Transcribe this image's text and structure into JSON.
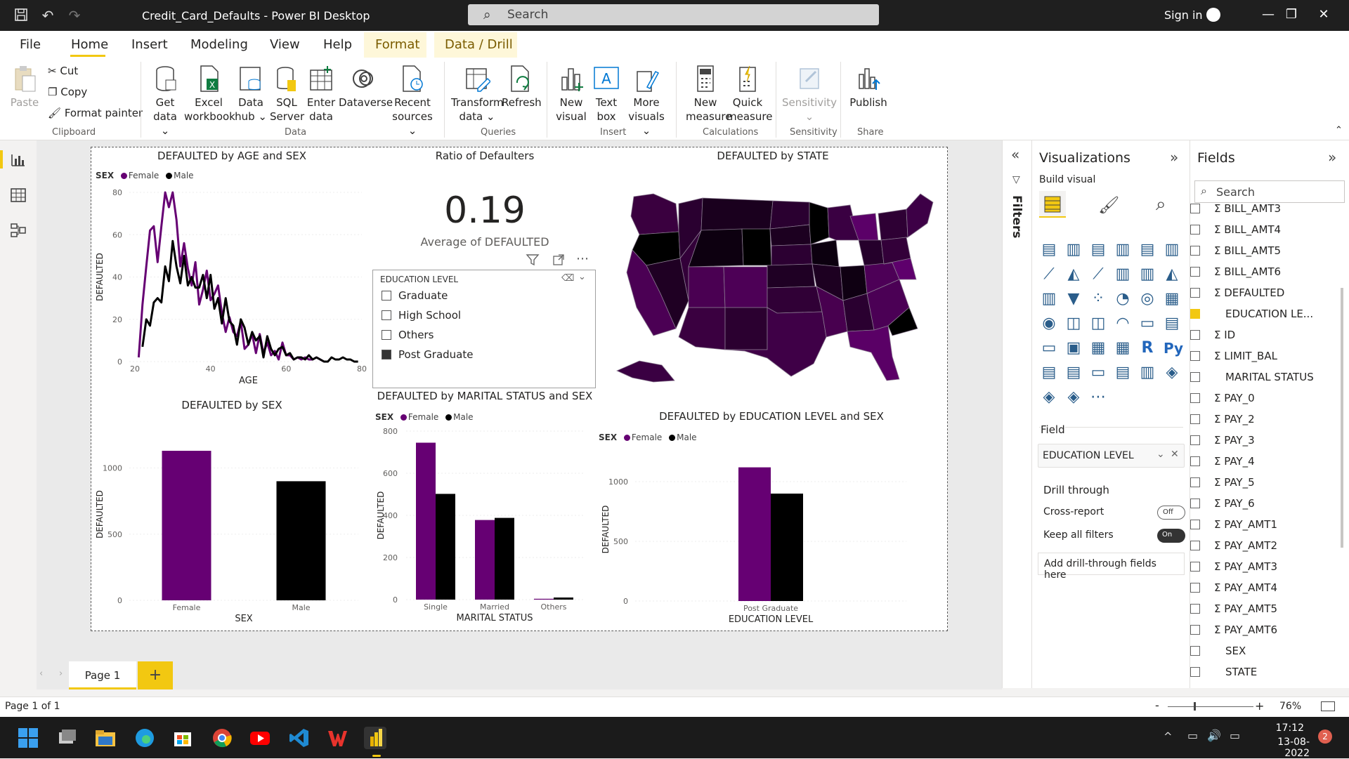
{
  "titlebar": {
    "title": "Credit_Card_Defaults - Power BI Desktop",
    "search_placeholder": "Search",
    "signin": "Sign in"
  },
  "menu": {
    "items": [
      "File",
      "Home",
      "Insert",
      "Modeling",
      "View",
      "Help",
      "Format",
      "Data / Drill"
    ]
  },
  "ribbon": {
    "clipboard": {
      "paste": "Paste",
      "cut": "Cut",
      "copy": "Copy",
      "format_painter": "Format painter",
      "label": "Clipboard"
    },
    "data": {
      "get_data": [
        "Get",
        "data ⌄"
      ],
      "excel": [
        "Excel",
        "workbook"
      ],
      "data_hub": [
        "Data",
        "hub ⌄"
      ],
      "sql": [
        "SQL",
        "Server"
      ],
      "enter": [
        "Enter",
        "data"
      ],
      "dataverse": [
        "Dataverse",
        ""
      ],
      "recent": [
        "Recent",
        "sources ⌄"
      ],
      "label": "Data"
    },
    "queries": {
      "transform": [
        "Transform",
        "data ⌄"
      ],
      "refresh": [
        "Refresh",
        ""
      ],
      "label": "Queries"
    },
    "insert": {
      "new_visual": [
        "New",
        "visual"
      ],
      "text_box": [
        "Text",
        "box"
      ],
      "more": [
        "More",
        "visuals ⌄"
      ],
      "label": "Insert"
    },
    "calculations": {
      "new_measure": [
        "New",
        "measure"
      ],
      "quick_measure": [
        "Quick",
        "measure"
      ],
      "label": "Calculations"
    },
    "sensitivity": {
      "btn": [
        "Sensitivity",
        "⌄"
      ],
      "label": "Sensitivity"
    },
    "share": {
      "publish": [
        "Publish",
        ""
      ],
      "label": "Share"
    }
  },
  "visuals": {
    "age_chart": {
      "title": "DEFAULTED by AGE and SEX",
      "legend_title": "SEX",
      "legend": [
        "Female",
        "Male"
      ],
      "xlabel": "AGE",
      "ylabel": "DEFAULTED"
    },
    "card": {
      "title": "Ratio of Defaulters",
      "value": "0.19",
      "label": "Average of DEFAULTED"
    },
    "slicer": {
      "title": "EDUCATION LEVEL",
      "items": [
        "Graduate",
        "High School",
        "Others",
        "Post Graduate"
      ],
      "selected": "Post Graduate"
    },
    "map": {
      "title": "DEFAULTED by STATE"
    },
    "sex_chart": {
      "title": "DEFAULTED by SEX",
      "xlabel": "SEX",
      "ylabel": "DEFAULTED"
    },
    "marital_chart": {
      "title": "DEFAULTED by MARITAL STATUS and SEX",
      "legend_title": "SEX",
      "legend": [
        "Female",
        "Male"
      ],
      "xlabel": "MARITAL STATUS",
      "ylabel": "DEFAULTED"
    },
    "edu_chart": {
      "title": "DEFAULTED by EDUCATION LEVEL and SEX",
      "legend_title": "SEX",
      "legend": [
        "Female",
        "Male"
      ],
      "xlabel": "EDUCATION LEVEL",
      "ylabel": "DEFAULTED"
    }
  },
  "colors": {
    "female": "#660073",
    "male": "#000000",
    "accent": "#f2c811"
  },
  "chart_data": [
    {
      "type": "line",
      "title": "DEFAULTED by AGE and SEX",
      "xlabel": "AGE",
      "ylabel": "DEFAULTED",
      "xlim": [
        20,
        80
      ],
      "ylim": [
        0,
        80
      ],
      "x_ticks": [
        20,
        40,
        60,
        80
      ],
      "y_ticks": [
        0,
        20,
        40,
        60,
        80
      ],
      "series": [
        {
          "name": "Female",
          "x": [
            21,
            22,
            23,
            24,
            25,
            26,
            27,
            28,
            29,
            30,
            31,
            32,
            33,
            34,
            35,
            36,
            37,
            38,
            39,
            40,
            41,
            42,
            43,
            44,
            45,
            46,
            47,
            48,
            49,
            50,
            51,
            52,
            53,
            54,
            55,
            56,
            57,
            58,
            59,
            60,
            61,
            62,
            63,
            64,
            65,
            66,
            67,
            68,
            69,
            70
          ],
          "y": [
            2,
            27,
            45,
            62,
            64,
            47,
            64,
            80,
            73,
            80,
            67,
            45,
            56,
            44,
            36,
            47,
            27,
            34,
            43,
            29,
            32,
            36,
            23,
            14,
            21,
            14,
            12,
            19,
            6,
            8,
            13,
            4,
            13,
            4,
            9,
            3,
            5,
            1,
            9,
            3,
            3,
            1,
            2,
            1,
            2,
            1,
            1,
            2,
            1,
            0
          ]
        },
        {
          "name": "Male",
          "x": [
            22,
            23,
            24,
            25,
            26,
            27,
            28,
            29,
            30,
            31,
            32,
            33,
            34,
            35,
            36,
            37,
            38,
            39,
            40,
            41,
            42,
            43,
            44,
            45,
            46,
            47,
            48,
            49,
            50,
            51,
            52,
            53,
            54,
            55,
            56,
            57,
            58,
            59,
            60,
            61,
            62,
            63,
            64,
            65,
            66,
            67,
            68,
            69,
            70,
            71,
            72,
            73,
            74,
            75,
            76,
            77,
            78,
            79
          ],
          "y": [
            7,
            20,
            17,
            28,
            30,
            28,
            45,
            38,
            57,
            45,
            37,
            50,
            36,
            40,
            35,
            35,
            41,
            30,
            41,
            25,
            30,
            18,
            30,
            19,
            17,
            8,
            20,
            16,
            8,
            14,
            10,
            12,
            2,
            12,
            6,
            3,
            6,
            7,
            3,
            4,
            1,
            2,
            2,
            1,
            3,
            1,
            2,
            1,
            0,
            0,
            2,
            1,
            1,
            2,
            1,
            1,
            0,
            0
          ]
        }
      ]
    },
    {
      "type": "bar",
      "title": "DEFAULTED by SEX",
      "xlabel": "SEX",
      "ylabel": "DEFAULTED",
      "categories": [
        "Female",
        "Male"
      ],
      "values": [
        1130,
        900
      ],
      "ylim": [
        0,
        1300
      ],
      "y_ticks": [
        0,
        500,
        1000
      ]
    },
    {
      "type": "bar",
      "title": "DEFAULTED by MARITAL STATUS and SEX",
      "xlabel": "MARITAL STATUS",
      "ylabel": "DEFAULTED",
      "categories": [
        "Single",
        "Married",
        "Others"
      ],
      "ylim": [
        0,
        800
      ],
      "y_ticks": [
        0,
        200,
        400,
        600,
        800
      ],
      "series": [
        {
          "name": "Female",
          "values": [
            745,
            378,
            4
          ]
        },
        {
          "name": "Male",
          "values": [
            502,
            388,
            10
          ]
        }
      ]
    },
    {
      "type": "bar",
      "title": "DEFAULTED by EDUCATION LEVEL and SEX",
      "xlabel": "EDUCATION LEVEL",
      "ylabel": "DEFAULTED",
      "categories": [
        "Post Graduate"
      ],
      "ylim": [
        0,
        1200
      ],
      "y_ticks": [
        0,
        500,
        1000
      ],
      "series": [
        {
          "name": "Female",
          "values": [
            1120
          ]
        },
        {
          "name": "Male",
          "values": [
            900
          ]
        }
      ]
    }
  ],
  "filters_label": "Filters",
  "viz_pane": {
    "title": "Visualizations",
    "build": "Build visual",
    "field_label": "Field",
    "field_value": "EDUCATION LEVEL",
    "drill_through": "Drill through",
    "cross_report": "Cross-report",
    "cross_report_state": "Off",
    "keep_filters": "Keep all filters",
    "keep_filters_state": "On",
    "add_drill": "Add drill-through fields here"
  },
  "fields_pane": {
    "title": "Fields",
    "search_placeholder": "Search",
    "fields": [
      {
        "name": "BILL_AMT3",
        "sigma": true,
        "checked": false
      },
      {
        "name": "BILL_AMT4",
        "sigma": true,
        "checked": false
      },
      {
        "name": "BILL_AMT5",
        "sigma": true,
        "checked": false
      },
      {
        "name": "BILL_AMT6",
        "sigma": true,
        "checked": false
      },
      {
        "name": "DEFAULTED",
        "sigma": true,
        "checked": false
      },
      {
        "name": "EDUCATION LE...",
        "sigma": false,
        "checked": true
      },
      {
        "name": "ID",
        "sigma": true,
        "checked": false
      },
      {
        "name": "LIMIT_BAL",
        "sigma": true,
        "checked": false
      },
      {
        "name": "MARITAL STATUS",
        "sigma": false,
        "checked": false
      },
      {
        "name": "PAY_0",
        "sigma": true,
        "checked": false
      },
      {
        "name": "PAY_2",
        "sigma": true,
        "checked": false
      },
      {
        "name": "PAY_3",
        "sigma": true,
        "checked": false
      },
      {
        "name": "PAY_4",
        "sigma": true,
        "checked": false
      },
      {
        "name": "PAY_5",
        "sigma": true,
        "checked": false
      },
      {
        "name": "PAY_6",
        "sigma": true,
        "checked": false
      },
      {
        "name": "PAY_AMT1",
        "sigma": true,
        "checked": false
      },
      {
        "name": "PAY_AMT2",
        "sigma": true,
        "checked": false
      },
      {
        "name": "PAY_AMT3",
        "sigma": true,
        "checked": false
      },
      {
        "name": "PAY_AMT4",
        "sigma": true,
        "checked": false
      },
      {
        "name": "PAY_AMT5",
        "sigma": true,
        "checked": false
      },
      {
        "name": "PAY_AMT6",
        "sigma": true,
        "checked": false
      },
      {
        "name": "SEX",
        "sigma": false,
        "checked": false
      },
      {
        "name": "STATE",
        "sigma": false,
        "checked": false
      }
    ]
  },
  "tabs": {
    "page1": "Page 1",
    "add": "+"
  },
  "status": {
    "page": "Page 1 of 1",
    "zoom": "76%"
  },
  "taskbar": {
    "time": "17:12",
    "date": "13-08-2022",
    "notif": "2"
  }
}
